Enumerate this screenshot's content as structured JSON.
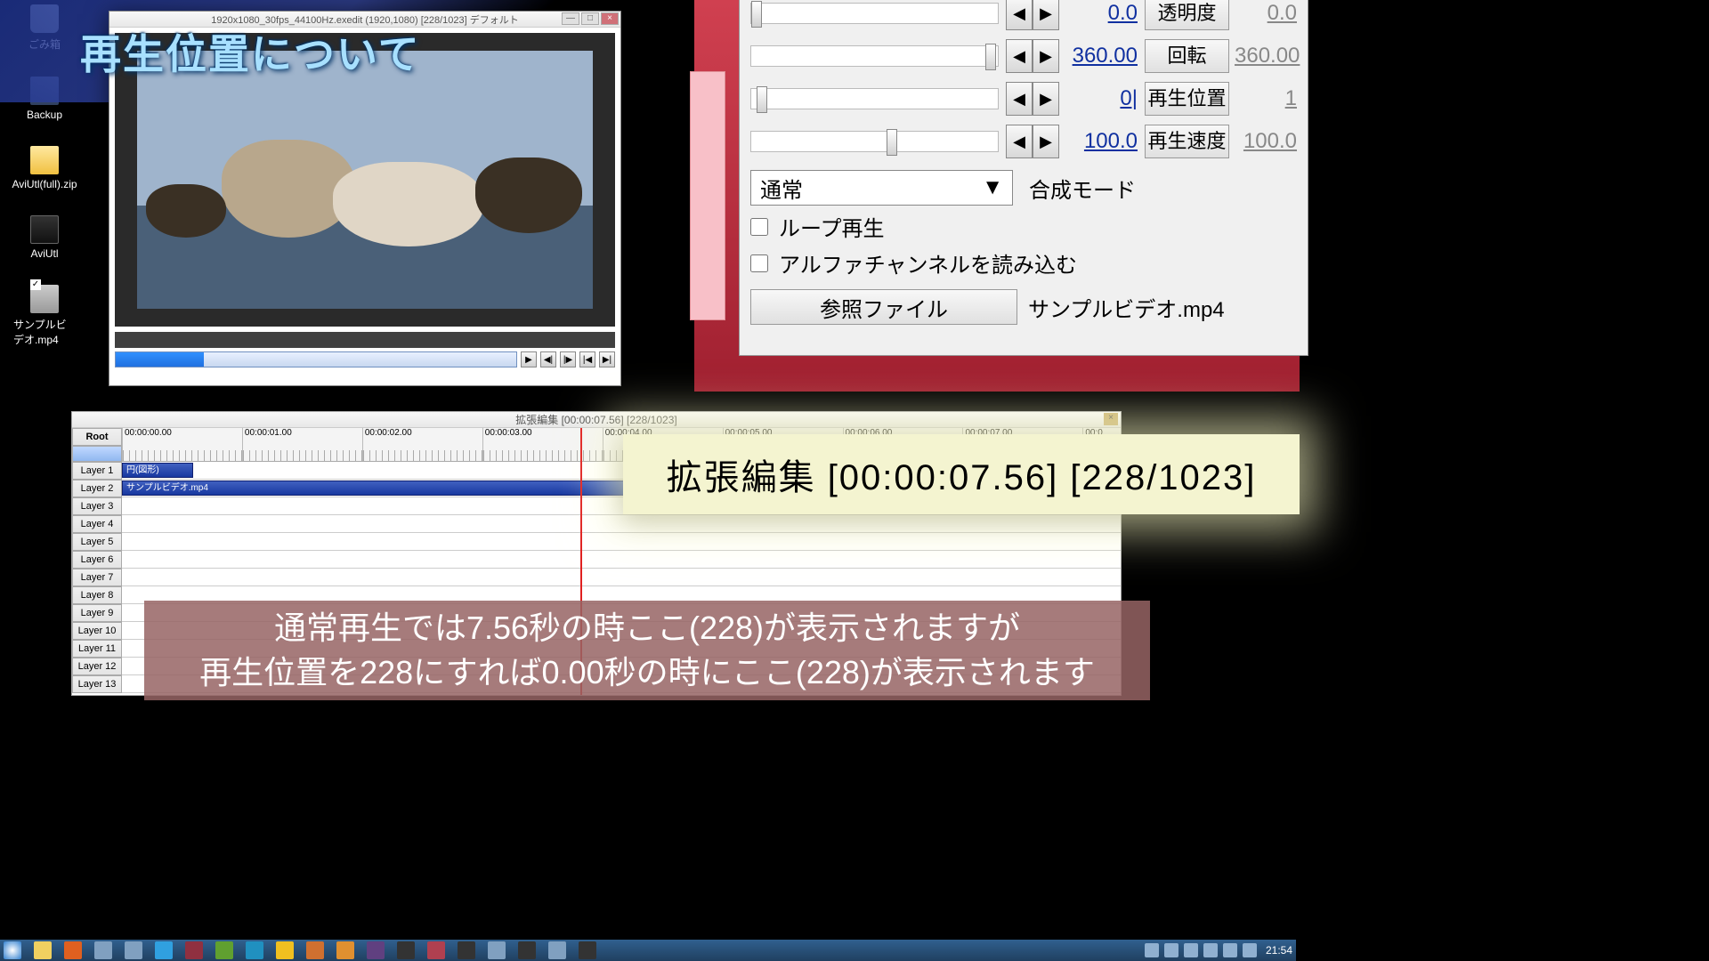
{
  "desktop": {
    "icons": [
      {
        "label": "ごみ箱",
        "type": "trash"
      },
      {
        "label": "Backup",
        "type": "folder"
      },
      {
        "label": "AviUtl(full).zip",
        "type": "zip"
      },
      {
        "label": "AviUtl",
        "type": "exe"
      },
      {
        "label": "サンプルビデオ.mp4",
        "type": "video"
      }
    ]
  },
  "banner_title": "再生位置について",
  "preview": {
    "title": "1920x1080_30fps_44100Hz.exedit (1920,1080)  [228/1023]  デフォルト",
    "buttons": {
      "play": "▶",
      "prevframe": "◀|",
      "nextframe": "|▶",
      "first": "|◀",
      "last": "▶|"
    }
  },
  "props": {
    "rows": [
      {
        "val": "0.0",
        "label": "透明度",
        "val2": "0.0",
        "thumb": 0
      },
      {
        "val": "360.00",
        "label": "回転",
        "val2": "360.00",
        "thumb": 95
      },
      {
        "val": "0|",
        "label": "再生位置",
        "val2": "1",
        "thumb": 2
      },
      {
        "val": "100.0",
        "label": "再生速度",
        "val2": "100.0",
        "thumb": 55
      }
    ],
    "blend_label": "合成モード",
    "blend_value": "通常",
    "loop": "ループ再生",
    "alpha": "アルファチャンネルを読み込む",
    "ref_btn": "参照ファイル",
    "ref_file": "サンプルビデオ.mp4"
  },
  "timeline": {
    "title": "拡張編集 [00:00:07.56] [228/1023]",
    "root": "Root",
    "layers": [
      "Layer 1",
      "Layer 2",
      "Layer 3",
      "Layer 4",
      "Layer 5",
      "Layer 6",
      "Layer 7",
      "Layer 8",
      "Layer 9",
      "Layer 10",
      "Layer 11",
      "Layer 12",
      "Layer 13"
    ],
    "ticks": [
      "00:00:00.00",
      "00:00:01.00",
      "00:00:02.00",
      "00:00:03.00",
      "00:00:04.00",
      "00:00:05.00",
      "00:00:06.00",
      "00:00:07.00",
      "00:0"
    ],
    "clip1": "円(図形)",
    "clip2": "サンプルビデオ.mp4"
  },
  "zoom_title": "拡張編集 [00:00:07.56] [228/1023]",
  "subtitle_l1": "通常再生では7.56秒の時ここ(228)が表示されますが",
  "subtitle_l2": "再生位置を228にすれば0.00秒の時にここ(228)が表示されます",
  "taskbar": {
    "clock": "21:54"
  }
}
